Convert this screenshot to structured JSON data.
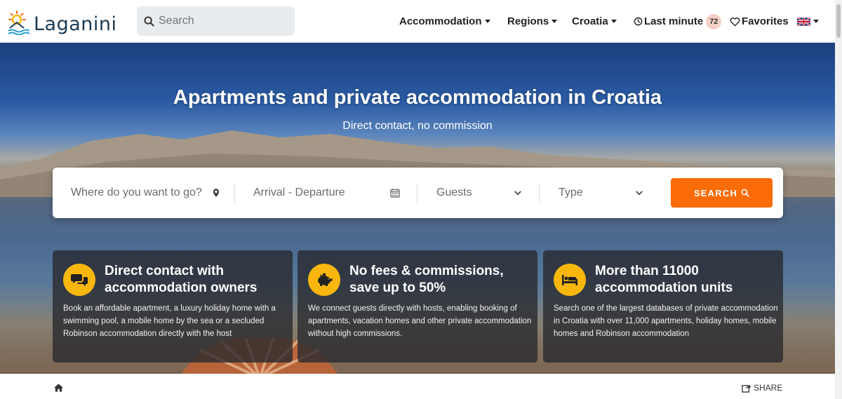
{
  "brand": {
    "name": "Laganini"
  },
  "search": {
    "placeholder": "Search"
  },
  "nav": {
    "accommodation": "Accommodation",
    "regions": "Regions",
    "croatia": "Croatia",
    "last_minute": "Last minute",
    "last_minute_count": "72",
    "favorites": "Favorites",
    "language_icon": "uk-flag-icon"
  },
  "hero": {
    "title": "Apartments and private accommodation in Croatia",
    "subtitle": "Direct contact, no commission"
  },
  "booking": {
    "destination_placeholder": "Where do you want to go?",
    "dates_placeholder": "Arrival - Departure",
    "guests_label": "Guests",
    "type_label": "Type",
    "search_label": "SEARCH"
  },
  "features": [
    {
      "icon": "chat-bubbles-icon",
      "title": "Direct contact with accommodation owners",
      "text": "Book an affordable apartment, a luxury holiday home with a swimming pool, a mobile home by the sea or a secluded Robinson accommodation directly with the host"
    },
    {
      "icon": "piggy-bank-icon",
      "title": "No fees & commissions, save up to 50%",
      "text": "We connect guests directly with hosts, enabling booking of apartments, vacation homes and other private accommodation without high commissions."
    },
    {
      "icon": "bed-icon",
      "title": "More than 11000 accommodation units",
      "text": "Search one of the largest databases of private accommodation in Croatia with over 11,000 apartments, holiday homes, mobile homes and Robinson accommodation"
    }
  ],
  "footer_bar": {
    "share_label": "SHARE"
  },
  "colors": {
    "accent": "#fb6b08",
    "icon_bg": "#f9b70e",
    "brand_text": "#1d3b52"
  }
}
